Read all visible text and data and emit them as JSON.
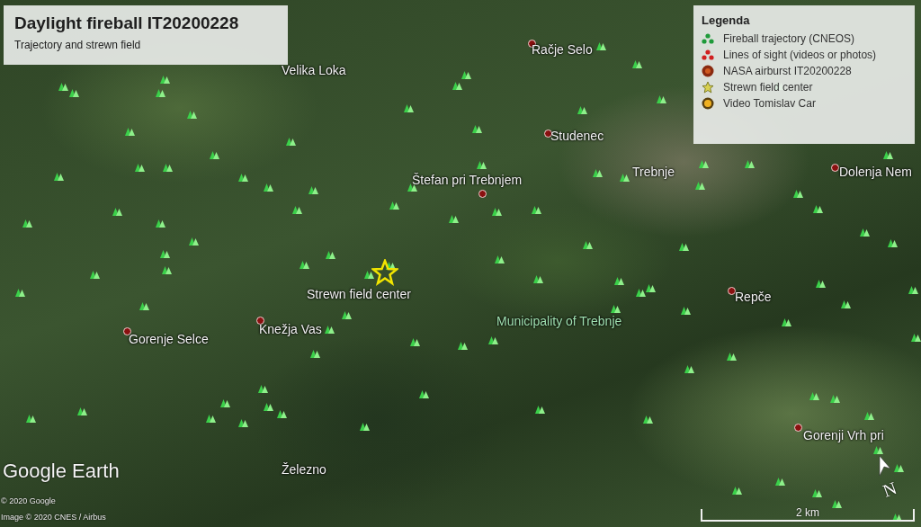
{
  "title_card": {
    "title": "Daylight fireball IT20200228",
    "subtitle": "Trajectory and strewn field"
  },
  "legend": {
    "title": "Legenda",
    "items": [
      {
        "kind": "trajectory",
        "label": "Fireball trajectory (CNEOS)"
      },
      {
        "kind": "sight",
        "label": "Lines of sight (videos or photos)"
      },
      {
        "kind": "airburst",
        "label": "NASA airburst IT20200228"
      },
      {
        "kind": "star",
        "label": "Strewn field center"
      },
      {
        "kind": "video",
        "label": "Video Tomislav Car"
      }
    ]
  },
  "places": [
    {
      "kind": "town",
      "name": "Velika Loka"
    },
    {
      "kind": "town",
      "name": "Račje Selo"
    },
    {
      "kind": "town",
      "name": "Studenec"
    },
    {
      "kind": "town",
      "name": "Trebnje"
    },
    {
      "kind": "town",
      "name": "Dolenja Nem"
    },
    {
      "kind": "town",
      "name": "Štefan pri Trebnjem"
    },
    {
      "kind": "center",
      "name": "Strewn field center"
    },
    {
      "kind": "region",
      "name": "Municipality of Trebnje"
    },
    {
      "kind": "town",
      "name": "Repče"
    },
    {
      "kind": "town",
      "name": "Gorenje Selce"
    },
    {
      "kind": "town",
      "name": "Knežja Vas"
    },
    {
      "kind": "plain",
      "name": "Železno"
    },
    {
      "kind": "town",
      "name": "Gorenji Vrh pri"
    }
  ],
  "attribution": {
    "logo": "Google Earth",
    "copyright": "© 2020 Google",
    "imagery": "Image © 2020 CNES / Airbus"
  },
  "scale": {
    "label": "2 km"
  },
  "compass": {
    "label": "N"
  }
}
